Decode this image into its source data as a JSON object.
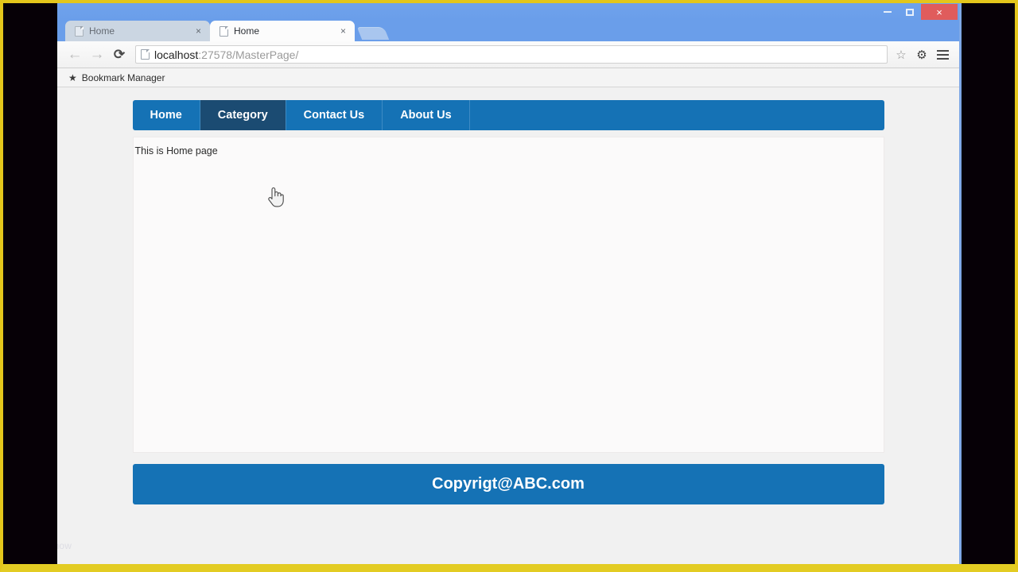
{
  "window": {
    "controls": {
      "minimize_label": "—",
      "maximize_label": "☐",
      "close_label": "×"
    }
  },
  "tabs": [
    {
      "title": "Home",
      "close_label": "×",
      "active": false
    },
    {
      "title": "Home",
      "close_label": "×",
      "active": true
    }
  ],
  "new_tab_label": "",
  "toolbar": {
    "back_label": "←",
    "forward_label": "→",
    "reload_label": "⟳",
    "url_host": "localhost",
    "url_rest": ":27578/MasterPage/",
    "star_label": "☆",
    "gear_label": "⚙"
  },
  "bookmarks_bar": {
    "items": [
      {
        "icon": "★",
        "label": "Bookmark Manager"
      }
    ]
  },
  "page": {
    "nav": {
      "items": [
        {
          "label": "Home",
          "state": "normal"
        },
        {
          "label": "Category",
          "state": "hover"
        },
        {
          "label": "Contact Us",
          "state": "normal"
        },
        {
          "label": "About Us",
          "state": "normal"
        }
      ]
    },
    "content": {
      "text": "This is Home page"
    },
    "footer": {
      "text": "Copyrigt@ABC.com"
    }
  },
  "watermark": {
    "text": "www.how"
  },
  "colors": {
    "nav_blue": "#1572B5",
    "nav_hover": "#1B4B72",
    "page_background": "#F1F1F1",
    "content_background": "#FBFAFA",
    "frame_border": "#E3C61B",
    "close_button": "#E05C5C",
    "browser_chrome": "#6A9EEA"
  }
}
